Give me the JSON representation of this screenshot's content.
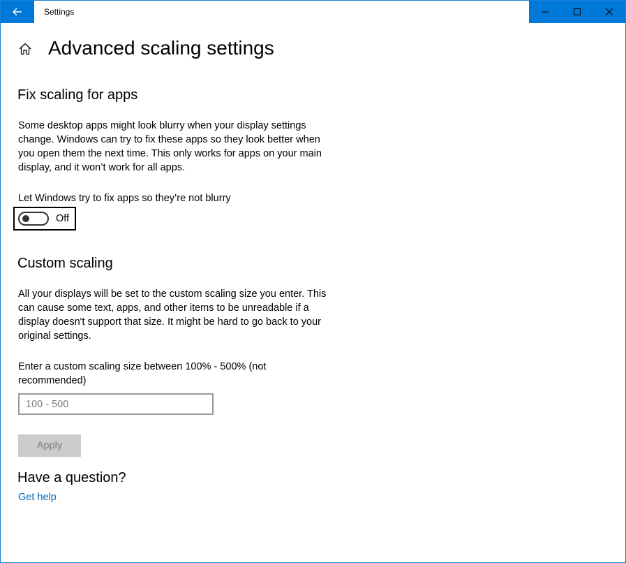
{
  "window": {
    "title": "Settings",
    "accent_color": "#0078d7"
  },
  "header": {
    "title": "Advanced scaling settings"
  },
  "fix_scaling": {
    "heading": "Fix scaling for apps",
    "description": "Some desktop apps might look blurry when your display settings change. Windows can try to fix these apps so they look better when you open them the next time. This only works for apps on your main display, and it won’t work for all apps.",
    "toggle_label": "Let Windows try to fix apps so they’re not blurry",
    "toggle_state": "Off"
  },
  "custom_scaling": {
    "heading": "Custom scaling",
    "description": "All your displays will be set to the custom scaling size you enter. This can cause some text, apps, and other items to be unreadable if a display doesn't support that size. It might be hard to go back to your original settings.",
    "input_label": "Enter a custom scaling size between 100% - 500% (not recommended)",
    "input_placeholder": "100 - 500",
    "input_value": "",
    "apply_label": "Apply"
  },
  "help": {
    "heading": "Have a question?",
    "link_label": "Get help"
  },
  "icons": {
    "back": "back-arrow-icon",
    "home": "home-icon",
    "minimize": "minimize-icon",
    "maximize": "maximize-icon",
    "close": "close-icon"
  }
}
